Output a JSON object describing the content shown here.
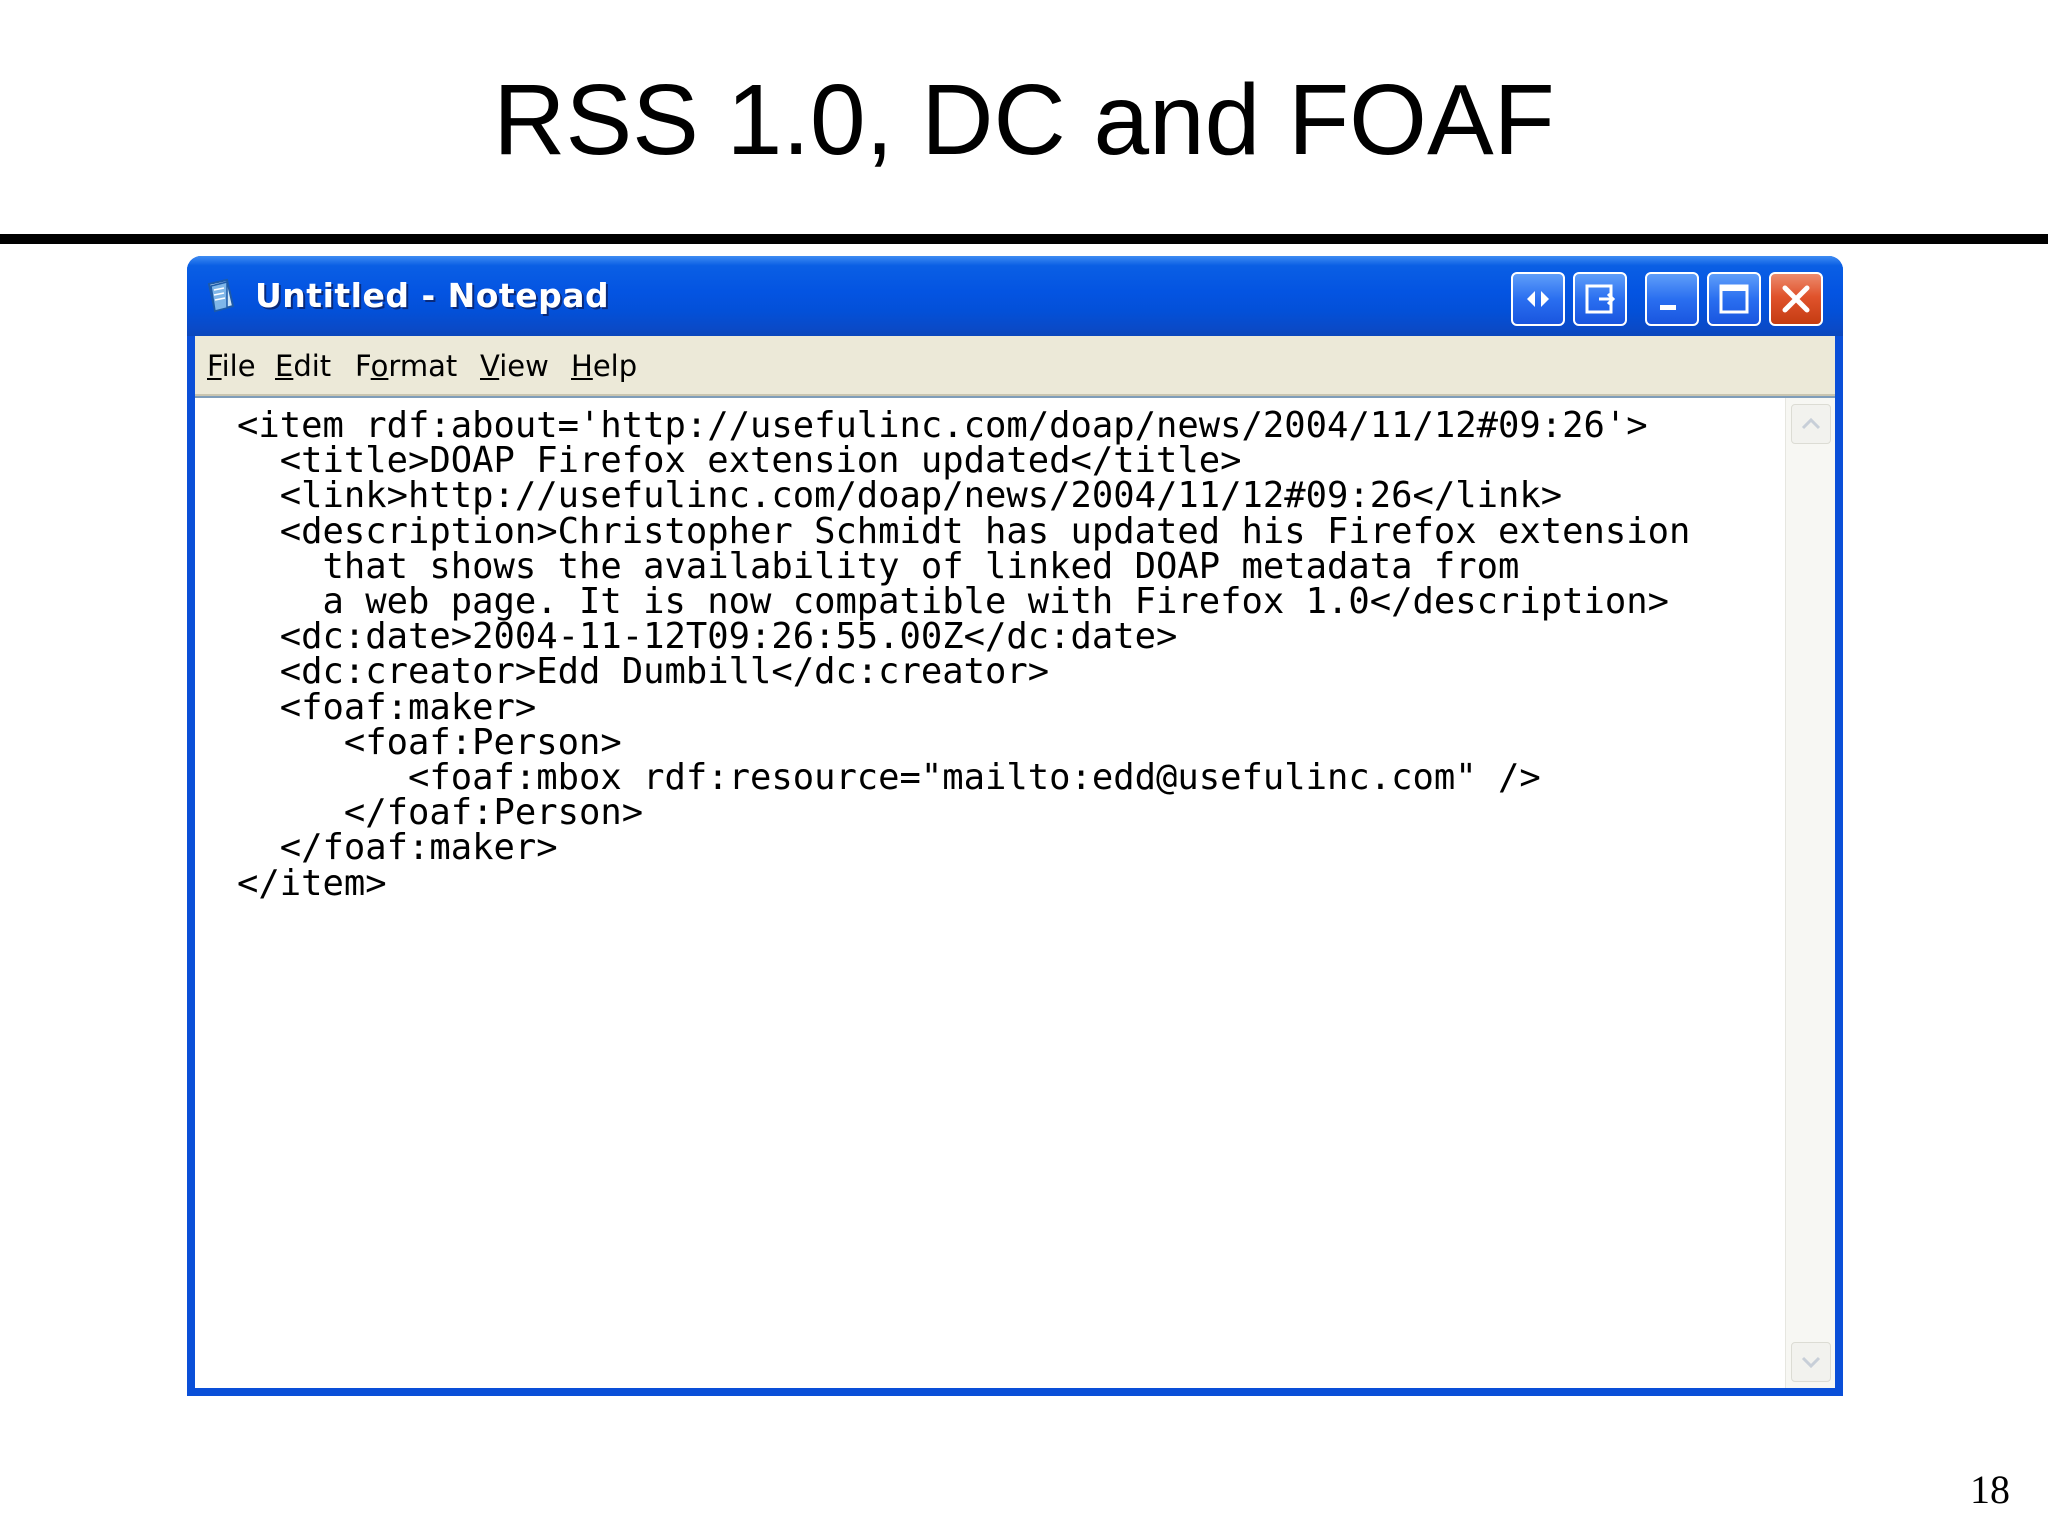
{
  "slide": {
    "title": "RSS 1.0, DC and FOAF",
    "page_number": "18"
  },
  "window": {
    "title": "Untitled - Notepad",
    "icon": "notepad-icon",
    "controls": [
      "restore-arrows-icon",
      "export-window-icon",
      "minimize-icon",
      "maximize-icon",
      "close-icon"
    ]
  },
  "menu": {
    "file": {
      "mnemonic": "F",
      "rest": "ile"
    },
    "edit": {
      "mnemonic": "E",
      "rest": "dit"
    },
    "format": {
      "pre": "F",
      "mnemonic": "o",
      "rest": "rmat"
    },
    "view": {
      "mnemonic": "V",
      "rest": "iew"
    },
    "help": {
      "mnemonic": "H",
      "rest": "elp"
    }
  },
  "editor": {
    "lines": [
      "<item rdf:about='http://usefulinc.com/doap/news/2004/11/12#09:26'>",
      "  <title>DOAP Firefox extension updated</title>",
      "  <link>http://usefulinc.com/doap/news/2004/11/12#09:26</link>",
      "  <description>Christopher Schmidt has updated his Firefox extension",
      "    that shows the availability of linked DOAP metadata from",
      "    a web page. It is now compatible with Firefox 1.0</description>",
      "  <dc:date>2004-11-12T09:26:55.00Z</dc:date>",
      "  <dc:creator>Edd Dumbill</dc:creator>",
      "  <foaf:maker>",
      "     <foaf:Person>",
      "        <foaf:mbox rdf:resource=\"mailto:edd@usefulinc.com\" />",
      "     </foaf:Person>",
      "  </foaf:maker>",
      "</item>"
    ]
  },
  "colors": {
    "titlebar": "#0454e2",
    "menubar": "#ece9d8",
    "close_button": "#e0532c"
  }
}
